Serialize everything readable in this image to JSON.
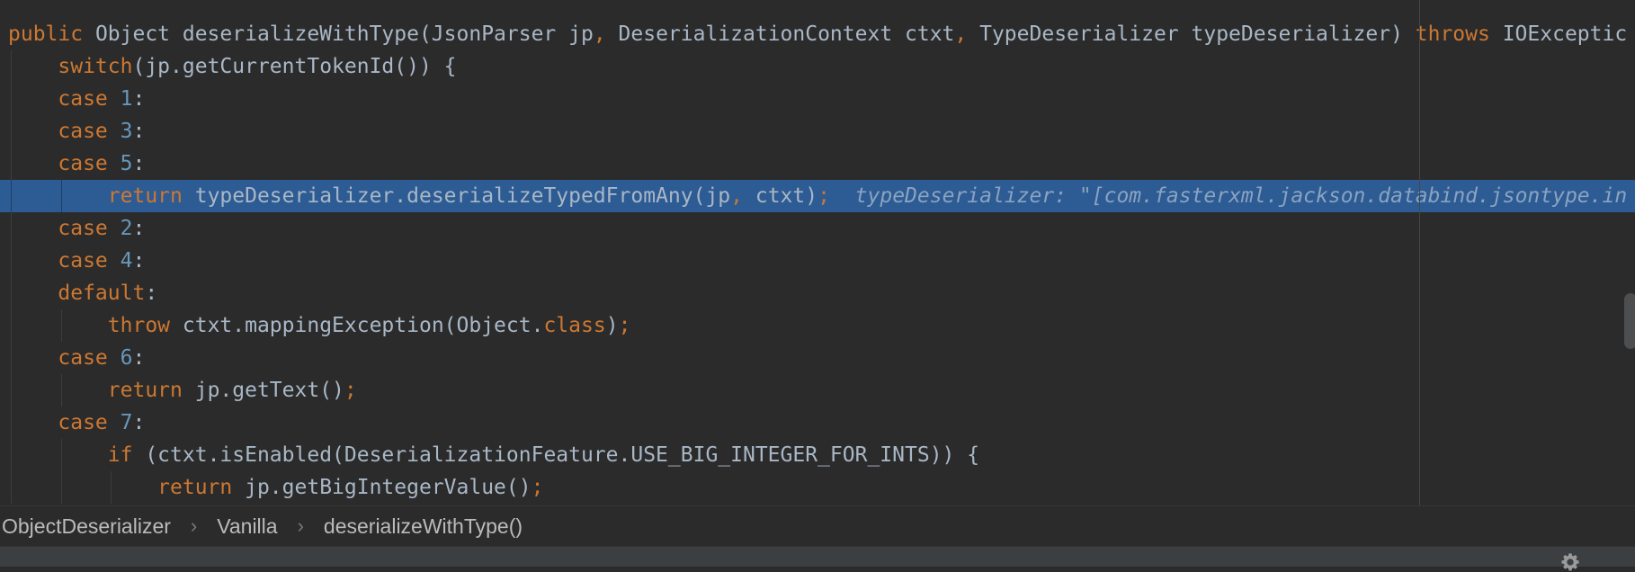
{
  "editor": {
    "lines": [
      {
        "highlighted": false,
        "tokens": [
          {
            "t": "public ",
            "c": "kw"
          },
          {
            "t": "Object deserializeWithType(JsonParser jp",
            "c": "pl"
          },
          {
            "t": ", ",
            "c": "kw"
          },
          {
            "t": "DeserializationContext ctxt",
            "c": "pl"
          },
          {
            "t": ", ",
            "c": "kw"
          },
          {
            "t": "TypeDeserializer typeDeserializer) ",
            "c": "pl"
          },
          {
            "t": "throws ",
            "c": "kw"
          },
          {
            "t": "IOExceptic",
            "c": "pl"
          }
        ]
      },
      {
        "highlighted": false,
        "tokens": [
          {
            "t": "    ",
            "c": "pl"
          },
          {
            "t": "switch",
            "c": "kw"
          },
          {
            "t": "(jp.getCurrentTokenId()) {",
            "c": "pl"
          }
        ]
      },
      {
        "highlighted": false,
        "tokens": [
          {
            "t": "    ",
            "c": "pl"
          },
          {
            "t": "case ",
            "c": "kw"
          },
          {
            "t": "1",
            "c": "num"
          },
          {
            "t": ":",
            "c": "pl"
          }
        ]
      },
      {
        "highlighted": false,
        "tokens": [
          {
            "t": "    ",
            "c": "pl"
          },
          {
            "t": "case ",
            "c": "kw"
          },
          {
            "t": "3",
            "c": "num"
          },
          {
            "t": ":",
            "c": "pl"
          }
        ]
      },
      {
        "highlighted": false,
        "tokens": [
          {
            "t": "    ",
            "c": "pl"
          },
          {
            "t": "case ",
            "c": "kw"
          },
          {
            "t": "5",
            "c": "num"
          },
          {
            "t": ":",
            "c": "pl"
          }
        ]
      },
      {
        "highlighted": true,
        "tokens": [
          {
            "t": "        ",
            "c": "pl"
          },
          {
            "t": "return ",
            "c": "kw"
          },
          {
            "t": "typeDeserializer.deserializeTypedFromAny(jp",
            "c": "pl"
          },
          {
            "t": ", ",
            "c": "kw"
          },
          {
            "t": "ctxt)",
            "c": "pl"
          },
          {
            "t": ";",
            "c": "kw"
          },
          {
            "t": "  typeDeserializer: \"[com.fasterxml.jackson.databind.jsontype.in",
            "c": "hint"
          }
        ]
      },
      {
        "highlighted": false,
        "tokens": [
          {
            "t": "    ",
            "c": "pl"
          },
          {
            "t": "case ",
            "c": "kw"
          },
          {
            "t": "2",
            "c": "num"
          },
          {
            "t": ":",
            "c": "pl"
          }
        ]
      },
      {
        "highlighted": false,
        "tokens": [
          {
            "t": "    ",
            "c": "pl"
          },
          {
            "t": "case ",
            "c": "kw"
          },
          {
            "t": "4",
            "c": "num"
          },
          {
            "t": ":",
            "c": "pl"
          }
        ]
      },
      {
        "highlighted": false,
        "tokens": [
          {
            "t": "    ",
            "c": "pl"
          },
          {
            "t": "default",
            "c": "kw"
          },
          {
            "t": ":",
            "c": "pl"
          }
        ]
      },
      {
        "highlighted": false,
        "tokens": [
          {
            "t": "        ",
            "c": "pl"
          },
          {
            "t": "throw ",
            "c": "kw"
          },
          {
            "t": "ctxt.mappingException(Object.",
            "c": "pl"
          },
          {
            "t": "class",
            "c": "kw"
          },
          {
            "t": ")",
            "c": "pl"
          },
          {
            "t": ";",
            "c": "kw"
          }
        ]
      },
      {
        "highlighted": false,
        "tokens": [
          {
            "t": "    ",
            "c": "pl"
          },
          {
            "t": "case ",
            "c": "kw"
          },
          {
            "t": "6",
            "c": "num"
          },
          {
            "t": ":",
            "c": "pl"
          }
        ]
      },
      {
        "highlighted": false,
        "tokens": [
          {
            "t": "        ",
            "c": "pl"
          },
          {
            "t": "return ",
            "c": "kw"
          },
          {
            "t": "jp.getText()",
            "c": "pl"
          },
          {
            "t": ";",
            "c": "kw"
          }
        ]
      },
      {
        "highlighted": false,
        "tokens": [
          {
            "t": "    ",
            "c": "pl"
          },
          {
            "t": "case ",
            "c": "kw"
          },
          {
            "t": "7",
            "c": "num"
          },
          {
            "t": ":",
            "c": "pl"
          }
        ]
      },
      {
        "highlighted": false,
        "tokens": [
          {
            "t": "        ",
            "c": "pl"
          },
          {
            "t": "if ",
            "c": "kw"
          },
          {
            "t": "(ctxt.isEnabled(DeserializationFeature.USE_BIG_INTEGER_FOR_INTS)) {",
            "c": "pl"
          }
        ]
      },
      {
        "highlighted": false,
        "tokens": [
          {
            "t": "            ",
            "c": "pl"
          },
          {
            "t": "return ",
            "c": "kw"
          },
          {
            "t": "jp.getBigIntegerValue()",
            "c": "pl"
          },
          {
            "t": ";",
            "c": "kw"
          }
        ]
      }
    ]
  },
  "breadcrumb": {
    "items": [
      "ObjectDeserializer",
      "Vanilla",
      "deserializeWithType()"
    ],
    "separator": "›"
  },
  "colors": {
    "background": "#2b2b2b",
    "keyword": "#cc7832",
    "number": "#6897bb",
    "plain": "#a9b7c6",
    "selection": "#2d5b93",
    "hint": "#8aa3c0",
    "status_bar": "#3c3f41"
  },
  "icons": {
    "status_bar_right": "gear-icon"
  }
}
